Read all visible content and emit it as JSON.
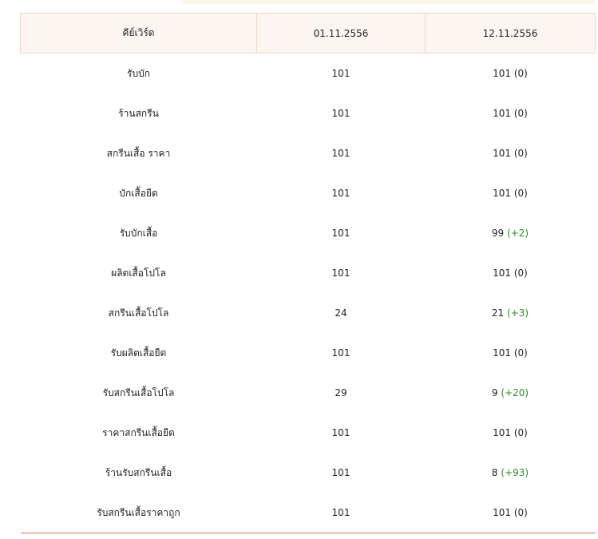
{
  "header": {
    "keyword": "คีย์เวิร์ด",
    "date1": "01.11.2556",
    "date2": "12.11.2556"
  },
  "rows": [
    {
      "keyword": "รับบัก",
      "rank1": "101",
      "rank2": "101",
      "change": "(0)",
      "trend": "flat"
    },
    {
      "keyword": "ร้านสกรีน",
      "rank1": "101",
      "rank2": "101",
      "change": "(0)",
      "trend": "flat"
    },
    {
      "keyword": "สกรีนเสื้อ ราคา",
      "rank1": "101",
      "rank2": "101",
      "change": "(0)",
      "trend": "flat"
    },
    {
      "keyword": "บักเสื้อยืด",
      "rank1": "101",
      "rank2": "101",
      "change": "(0)",
      "trend": "flat"
    },
    {
      "keyword": "รับบักเสื้อ",
      "rank1": "101",
      "rank2": "99",
      "change": "(+2)",
      "trend": "up"
    },
    {
      "keyword": "ผลิตเสื้อโปโล",
      "rank1": "101",
      "rank2": "101",
      "change": "(0)",
      "trend": "flat"
    },
    {
      "keyword": "สกรีนเสื้อโปโล",
      "rank1": "24",
      "rank2": "21",
      "change": "(+3)",
      "trend": "up"
    },
    {
      "keyword": "รับผลิตเสื้อยืด",
      "rank1": "101",
      "rank2": "101",
      "change": "(0)",
      "trend": "flat"
    },
    {
      "keyword": "รับสกรีนเสื้อโปโล",
      "rank1": "29",
      "rank2": "9",
      "change": "(+20)",
      "trend": "up"
    },
    {
      "keyword": "ราคาสกรีนเสื้อยืด",
      "rank1": "101",
      "rank2": "101",
      "change": "(0)",
      "trend": "flat"
    },
    {
      "keyword": "ร้านรับสกรีนเสื้อ",
      "rank1": "101",
      "rank2": "8",
      "change": "(+93)",
      "trend": "up"
    },
    {
      "keyword": "รับสกรีนเสื้อราคาถูก",
      "rank1": "101",
      "rank2": "101",
      "change": "(0)",
      "trend": "flat"
    }
  ],
  "colors": {
    "header_bg": "#fdf5f1",
    "positive_change": "#2e8b2e",
    "bottom_rule": "#d9715f"
  }
}
